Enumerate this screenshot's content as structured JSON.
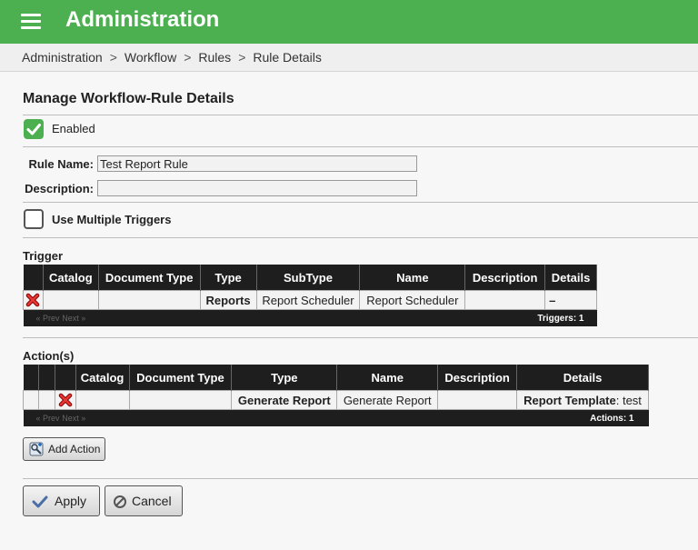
{
  "header": {
    "title": "Administration",
    "menu_icon": "hamburger-icon",
    "color": "#4caf50"
  },
  "breadcrumb": [
    "Administration",
    "Workflow",
    "Rules",
    "Rule Details"
  ],
  "breadcrumb_sep": ">",
  "page": {
    "title": "Manage Workflow-Rule Details"
  },
  "enabled": {
    "label": "Enabled",
    "checked": true
  },
  "rule_name": {
    "label": "Rule Name:",
    "value": "Test Report Rule"
  },
  "description": {
    "label": "Description:",
    "value": ""
  },
  "multiple_triggers": {
    "label": "Use Multiple Triggers",
    "checked": false
  },
  "trigger": {
    "title": "Trigger",
    "columns": [
      "Catalog",
      "Document Type",
      "Type",
      "SubType",
      "Name",
      "Description",
      "Details"
    ],
    "rows": [
      {
        "catalog": "",
        "document_type": "",
        "type": "Reports",
        "subtype": "Report Scheduler",
        "name": "Report Scheduler",
        "description": "",
        "details": "–"
      }
    ],
    "pager_prev": "« Prev",
    "pager_next": "Next »",
    "count": "Triggers: 1"
  },
  "actions": {
    "title": "Action(s)",
    "columns": [
      "Catalog",
      "Document Type",
      "Type",
      "Name",
      "Description",
      "Details"
    ],
    "rows": [
      {
        "catalog": "",
        "document_type": "",
        "type": "Generate Report",
        "name": "Generate Report",
        "description": "",
        "details_label": "Report Template",
        "details_value": ": test"
      }
    ],
    "pager_prev": "« Prev",
    "pager_next": "Next »",
    "count": "Actions: 1"
  },
  "add_action": {
    "label": "Add Action"
  },
  "footer": {
    "apply": "Apply",
    "cancel": "Cancel"
  }
}
